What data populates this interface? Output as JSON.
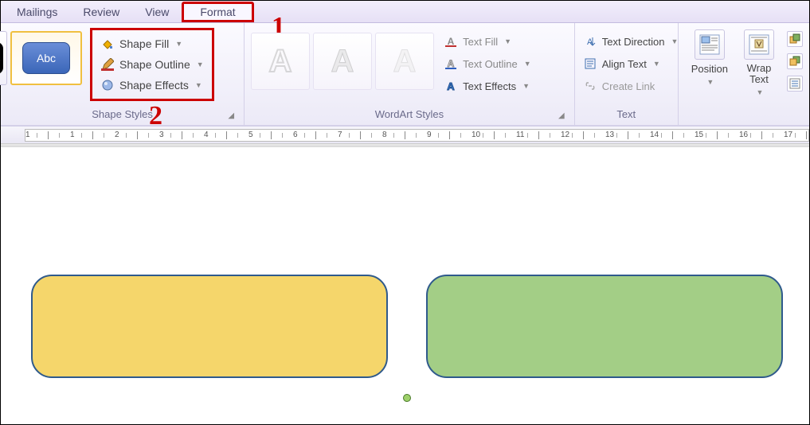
{
  "tabs": {
    "mailings": "Mailings",
    "review": "Review",
    "view": "View",
    "format": "Format"
  },
  "annotations": {
    "one": "1",
    "two": "2"
  },
  "ribbon": {
    "shape_styles": {
      "label": "Shape Styles",
      "thumb_text": "Abc",
      "fill": "Shape Fill",
      "outline": "Shape Outline",
      "effects": "Shape Effects"
    },
    "wordart": {
      "label": "WordArt Styles",
      "text_fill": "Text Fill",
      "text_outline": "Text Outline",
      "text_effects": "Text Effects"
    },
    "text": {
      "label": "Text",
      "direction": "Text Direction",
      "align": "Align Text",
      "link": "Create Link"
    },
    "arrange": {
      "position": "Position",
      "wrap1": "Wrap",
      "wrap2": "Text"
    }
  },
  "ruler": {
    "numbers": [
      "1",
      "1",
      "2",
      "3",
      "4",
      "5",
      "6",
      "7",
      "8",
      "9",
      "10",
      "11",
      "12",
      "13",
      "14",
      "15",
      "16",
      "17"
    ]
  }
}
